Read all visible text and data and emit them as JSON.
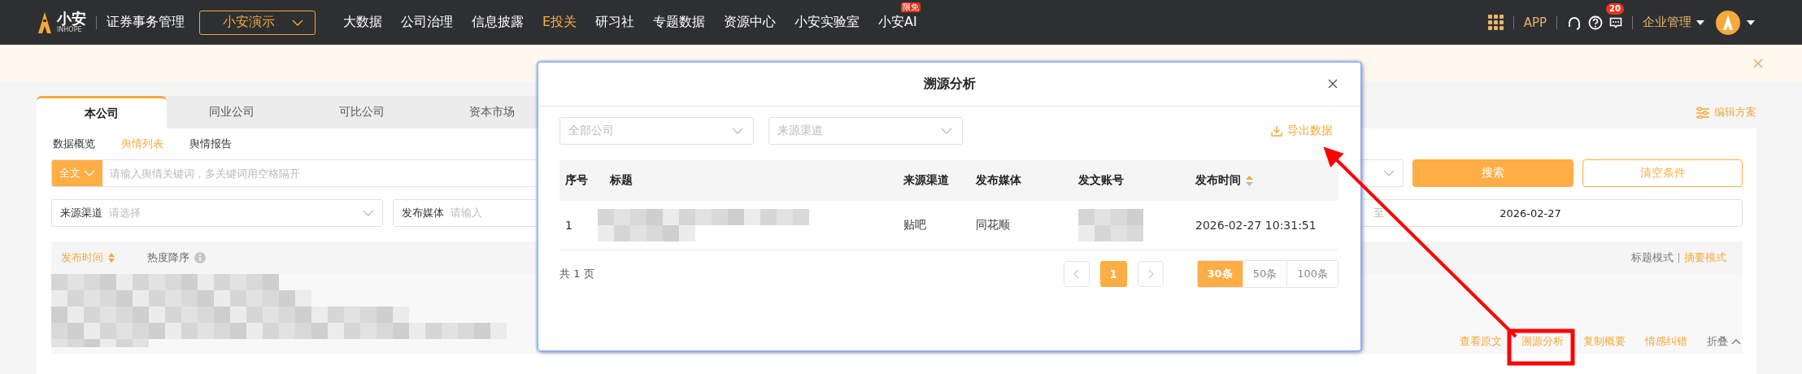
{
  "topbar": {
    "logo": "小安",
    "logo_sub": "INHOPE",
    "product": "证券事务管理",
    "org_select": "小安演示",
    "nav": [
      {
        "label": "大数据",
        "selected": false
      },
      {
        "label": "公司治理",
        "selected": false
      },
      {
        "label": "信息披露",
        "selected": false
      },
      {
        "label": "E投关",
        "selected": true
      },
      {
        "label": "研习社",
        "selected": false
      },
      {
        "label": "专题数据",
        "selected": false
      },
      {
        "label": "资源中心",
        "selected": false
      },
      {
        "label": "小安实验室",
        "selected": false
      },
      {
        "label": "小安AI",
        "selected": false,
        "badge": "限免"
      }
    ],
    "app_link": "APP",
    "message_count": "20",
    "enterprise_menu": "企业管理"
  },
  "company_tabs": [
    {
      "label": "本公司",
      "selected": true
    },
    {
      "label": "同业公司",
      "selected": false
    },
    {
      "label": "可比公司",
      "selected": false
    },
    {
      "label": "资本市场",
      "selected": false
    }
  ],
  "edit_scheme": "编辑方案",
  "sub_tabs": [
    {
      "label": "数据概览",
      "selected": false
    },
    {
      "label": "舆情列表",
      "selected": true
    },
    {
      "label": "舆情报告",
      "selected": false
    }
  ],
  "search": {
    "scope": "全文",
    "placeholder": "请输入舆情关键词，多关键词用空格隔开",
    "search_button": "搜索",
    "clear_button": "清空条件"
  },
  "filters": [
    {
      "label": "来源渠道",
      "placeholder": "请选择",
      "kind": "select"
    },
    {
      "label": "发布媒体",
      "placeholder": "请输入",
      "kind": "input"
    }
  ],
  "date_range": {
    "separator": "至",
    "end": "2026-02-27"
  },
  "sort": [
    {
      "label": "发布时间",
      "selected": true,
      "kind": "sortable"
    },
    {
      "label": "热度降序",
      "selected": false,
      "kind": "info"
    }
  ],
  "view_modes": [
    {
      "label": "标题模式",
      "selected": false
    },
    {
      "label": "摘要模式",
      "selected": true
    }
  ],
  "item_actions": [
    {
      "label": "查看原文",
      "kind": "link"
    },
    {
      "label": "溯源分析",
      "kind": "link"
    },
    {
      "label": "复制概要",
      "kind": "link"
    },
    {
      "label": "情感纠错",
      "kind": "link"
    },
    {
      "label": "折叠",
      "kind": "collapse"
    }
  ],
  "modal": {
    "title": "溯源分析",
    "filters": [
      {
        "placeholder": "全部公司"
      },
      {
        "placeholder": "来源渠道"
      }
    ],
    "export": "导出数据",
    "columns": [
      {
        "label": "序号"
      },
      {
        "label": "标题"
      },
      {
        "label": "来源渠道"
      },
      {
        "label": "发布媒体"
      },
      {
        "label": "发文账号"
      },
      {
        "label": "发布时间",
        "sort_ascending": true
      }
    ],
    "rows": [
      {
        "index": "1",
        "source": "贴吧",
        "media": "同花顺",
        "published": "2026-02-27 10:31:51"
      }
    ],
    "total": "共 1 页",
    "pages": [
      {
        "label": "1",
        "selected": true
      }
    ],
    "page_sizes": [
      {
        "label": "30条",
        "selected": true
      },
      {
        "label": "50条",
        "selected": false
      },
      {
        "label": "100条",
        "selected": false
      }
    ]
  }
}
